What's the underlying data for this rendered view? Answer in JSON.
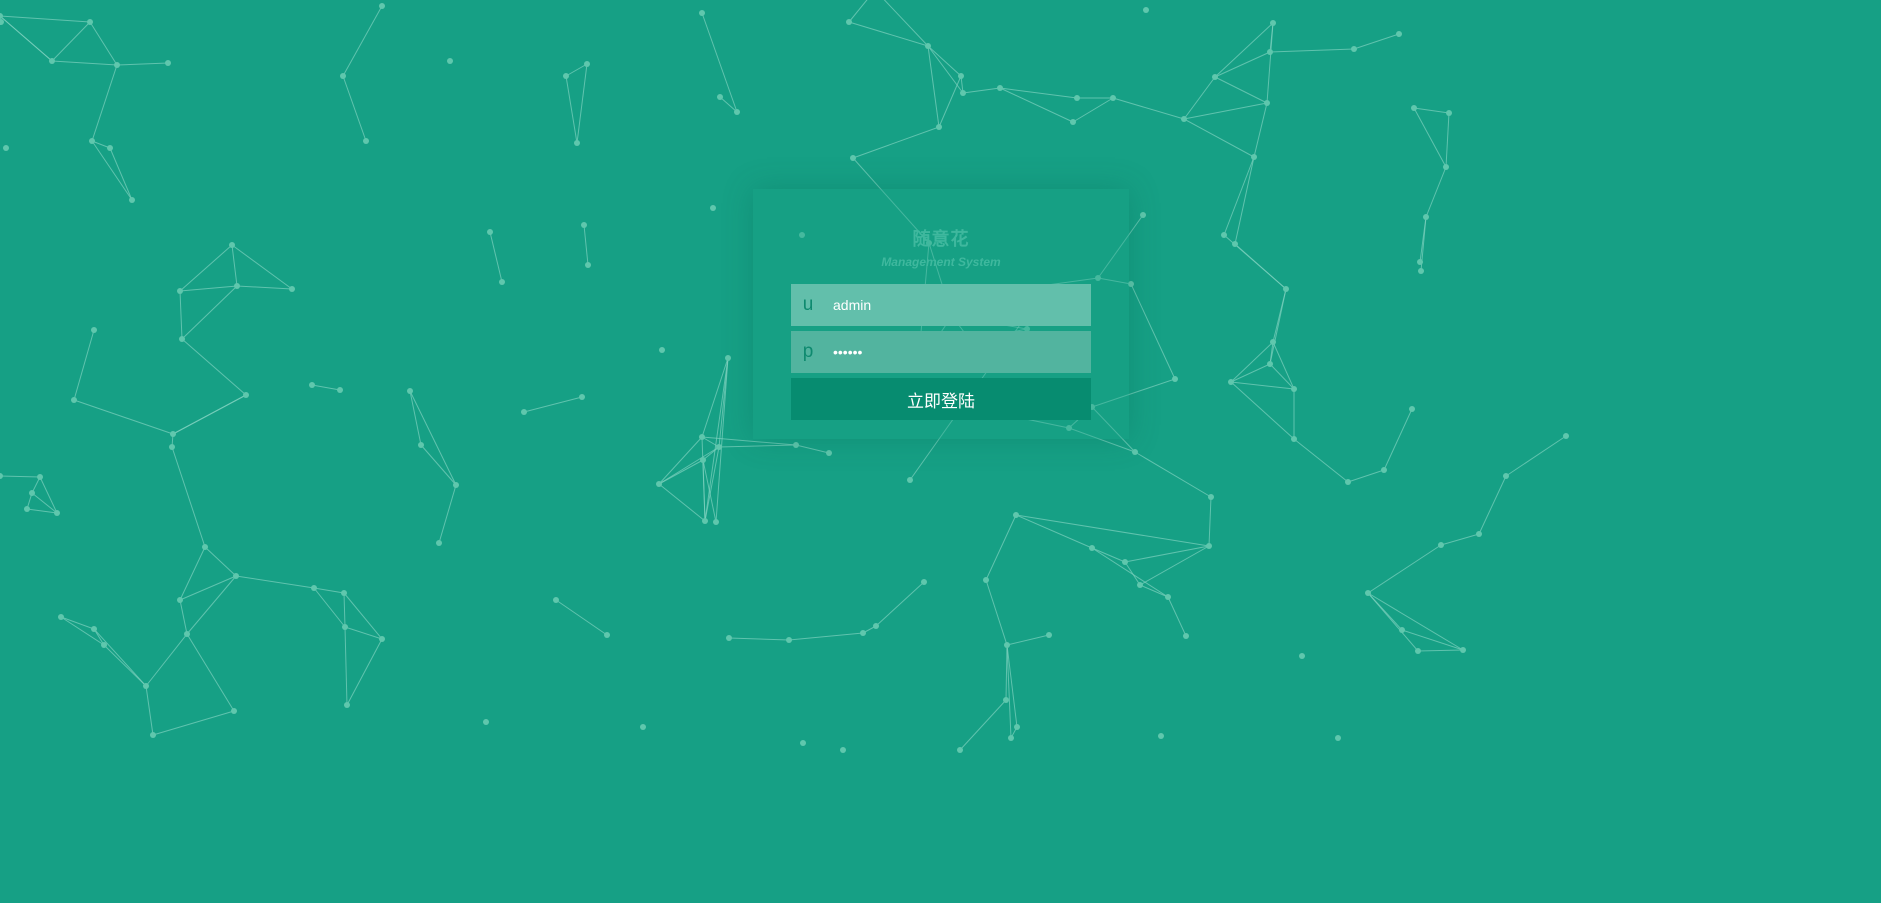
{
  "colors": {
    "background": "#16a085",
    "network_lines": "#7fd1bf",
    "network_nodes": "#5fc7ad",
    "username_field_bg": "#62bfab",
    "password_field_bg": "#52b49f",
    "login_button_bg": "#078c70"
  },
  "login": {
    "title": "随意花",
    "subtitle": "Management System",
    "username": {
      "prefix_icon": "u",
      "value": "admin"
    },
    "password": {
      "prefix_icon": "p",
      "value": "123456"
    },
    "submit_label": "立即登陆"
  }
}
